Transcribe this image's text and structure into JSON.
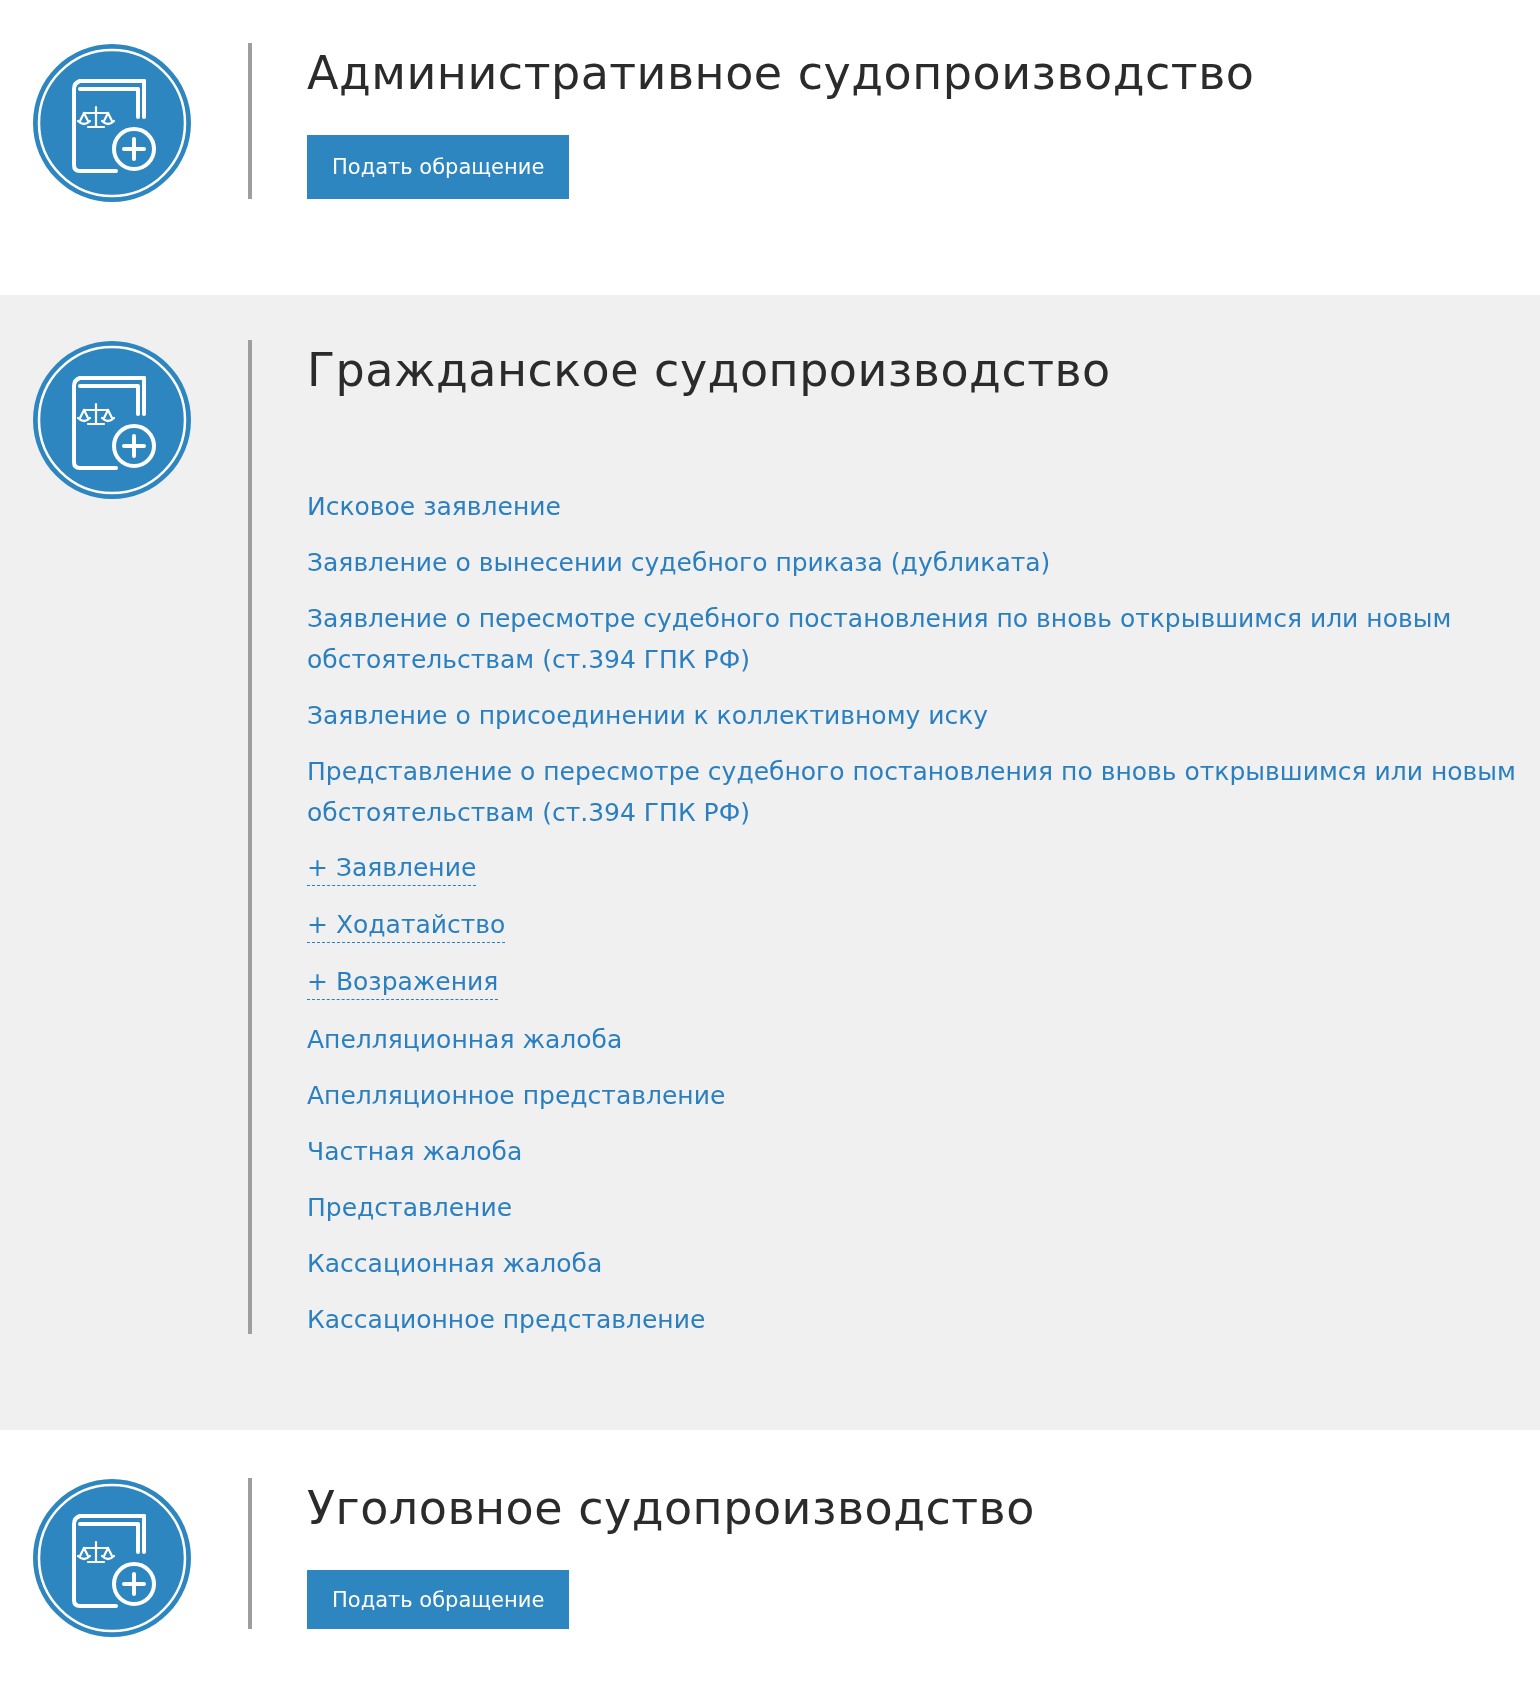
{
  "sections": [
    {
      "title": "Административное судопроизводство",
      "shaded": false,
      "button": "Подать обращение"
    },
    {
      "title": "Гражданское судопроизводство",
      "shaded": true,
      "links": [
        {
          "kind": "link",
          "label": "Исковое заявление"
        },
        {
          "kind": "link",
          "label": "Заявление о вынесении судебного приказа (дубликата)"
        },
        {
          "kind": "link",
          "label": "Заявление о пересмотре судебного постановления по вновь открывшимся или новым обстоятельствам (ст.394 ГПК РФ)"
        },
        {
          "kind": "link",
          "label": "Заявление о присоединении к коллективному иску"
        },
        {
          "kind": "link",
          "label": "Представление о пересмотре судебного постановления по вновь открывшимся или новым обстоятельствам (ст.394 ГПК РФ)"
        },
        {
          "kind": "expand",
          "label": "+ Заявление"
        },
        {
          "kind": "expand",
          "label": "+ Ходатайство"
        },
        {
          "kind": "expand",
          "label": "+ Возражения"
        },
        {
          "kind": "link",
          "label": "Апелляционная жалоба"
        },
        {
          "kind": "link",
          "label": "Апелляционное представление"
        },
        {
          "kind": "link",
          "label": "Частная жалоба"
        },
        {
          "kind": "link",
          "label": "Представление"
        },
        {
          "kind": "link",
          "label": "Кассационная жалоба"
        },
        {
          "kind": "link",
          "label": "Кассационное представление"
        }
      ]
    },
    {
      "title": "Уголовное судопроизводство",
      "shaded": false,
      "button": "Подать обращение"
    }
  ]
}
